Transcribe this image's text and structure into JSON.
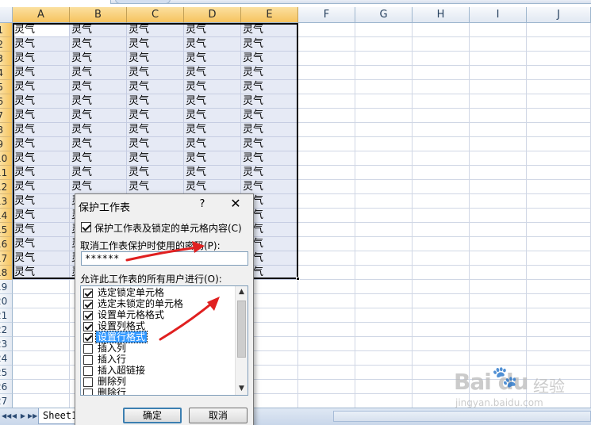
{
  "spreadsheet": {
    "columns": [
      "A",
      "B",
      "C",
      "D",
      "E",
      "F",
      "G",
      "H",
      "I",
      "J"
    ],
    "selected_columns": [
      "A",
      "B",
      "C",
      "D",
      "E"
    ],
    "rows": [
      "1",
      "2",
      "3",
      "4",
      "5",
      "6",
      "7",
      "8",
      "9",
      "10",
      "11",
      "12",
      "13",
      "14",
      "15",
      "16",
      "17",
      "18",
      "19",
      "20",
      "21",
      "22",
      "23",
      "24",
      "25",
      "26",
      "27"
    ],
    "selected_rows": 18,
    "cell_text": "灵气",
    "filled_columns": 5,
    "filled_rows": 18
  },
  "sheet_tabs": {
    "nav": [
      "◀◀",
      "◀",
      "▶",
      "▶▶"
    ],
    "active_tab": "Sheet1"
  },
  "dialog": {
    "title": "保护工作表",
    "help": "?",
    "close": "✕",
    "protect_label": "保护工作表及锁定的单元格内容(C)",
    "protect_checked": true,
    "password_label": "取消工作表保护时使用的密码(P):",
    "password_value": "******",
    "allow_label": "允许此工作表的所有用户进行(O):",
    "permissions": [
      {
        "label": "选定锁定单元格",
        "checked": true,
        "highlighted": false
      },
      {
        "label": "选定未锁定的单元格",
        "checked": true,
        "highlighted": false
      },
      {
        "label": "设置单元格格式",
        "checked": true,
        "highlighted": false
      },
      {
        "label": "设置列格式",
        "checked": true,
        "highlighted": false
      },
      {
        "label": "设置行格式",
        "checked": true,
        "highlighted": true
      },
      {
        "label": "插入列",
        "checked": false,
        "highlighted": false
      },
      {
        "label": "插入行",
        "checked": false,
        "highlighted": false
      },
      {
        "label": "插入超链接",
        "checked": false,
        "highlighted": false
      },
      {
        "label": "删除列",
        "checked": false,
        "highlighted": false
      },
      {
        "label": "删除行",
        "checked": false,
        "highlighted": false
      }
    ],
    "scroll_up": "▲",
    "scroll_down": "▼",
    "ok_label": "确定",
    "cancel_label": "取消"
  },
  "annotation": {
    "arrow_color": "#e02020"
  },
  "watermark": {
    "logo": "Bai  du",
    "suffix": "经验",
    "url": "jingyan.baidu.com"
  }
}
